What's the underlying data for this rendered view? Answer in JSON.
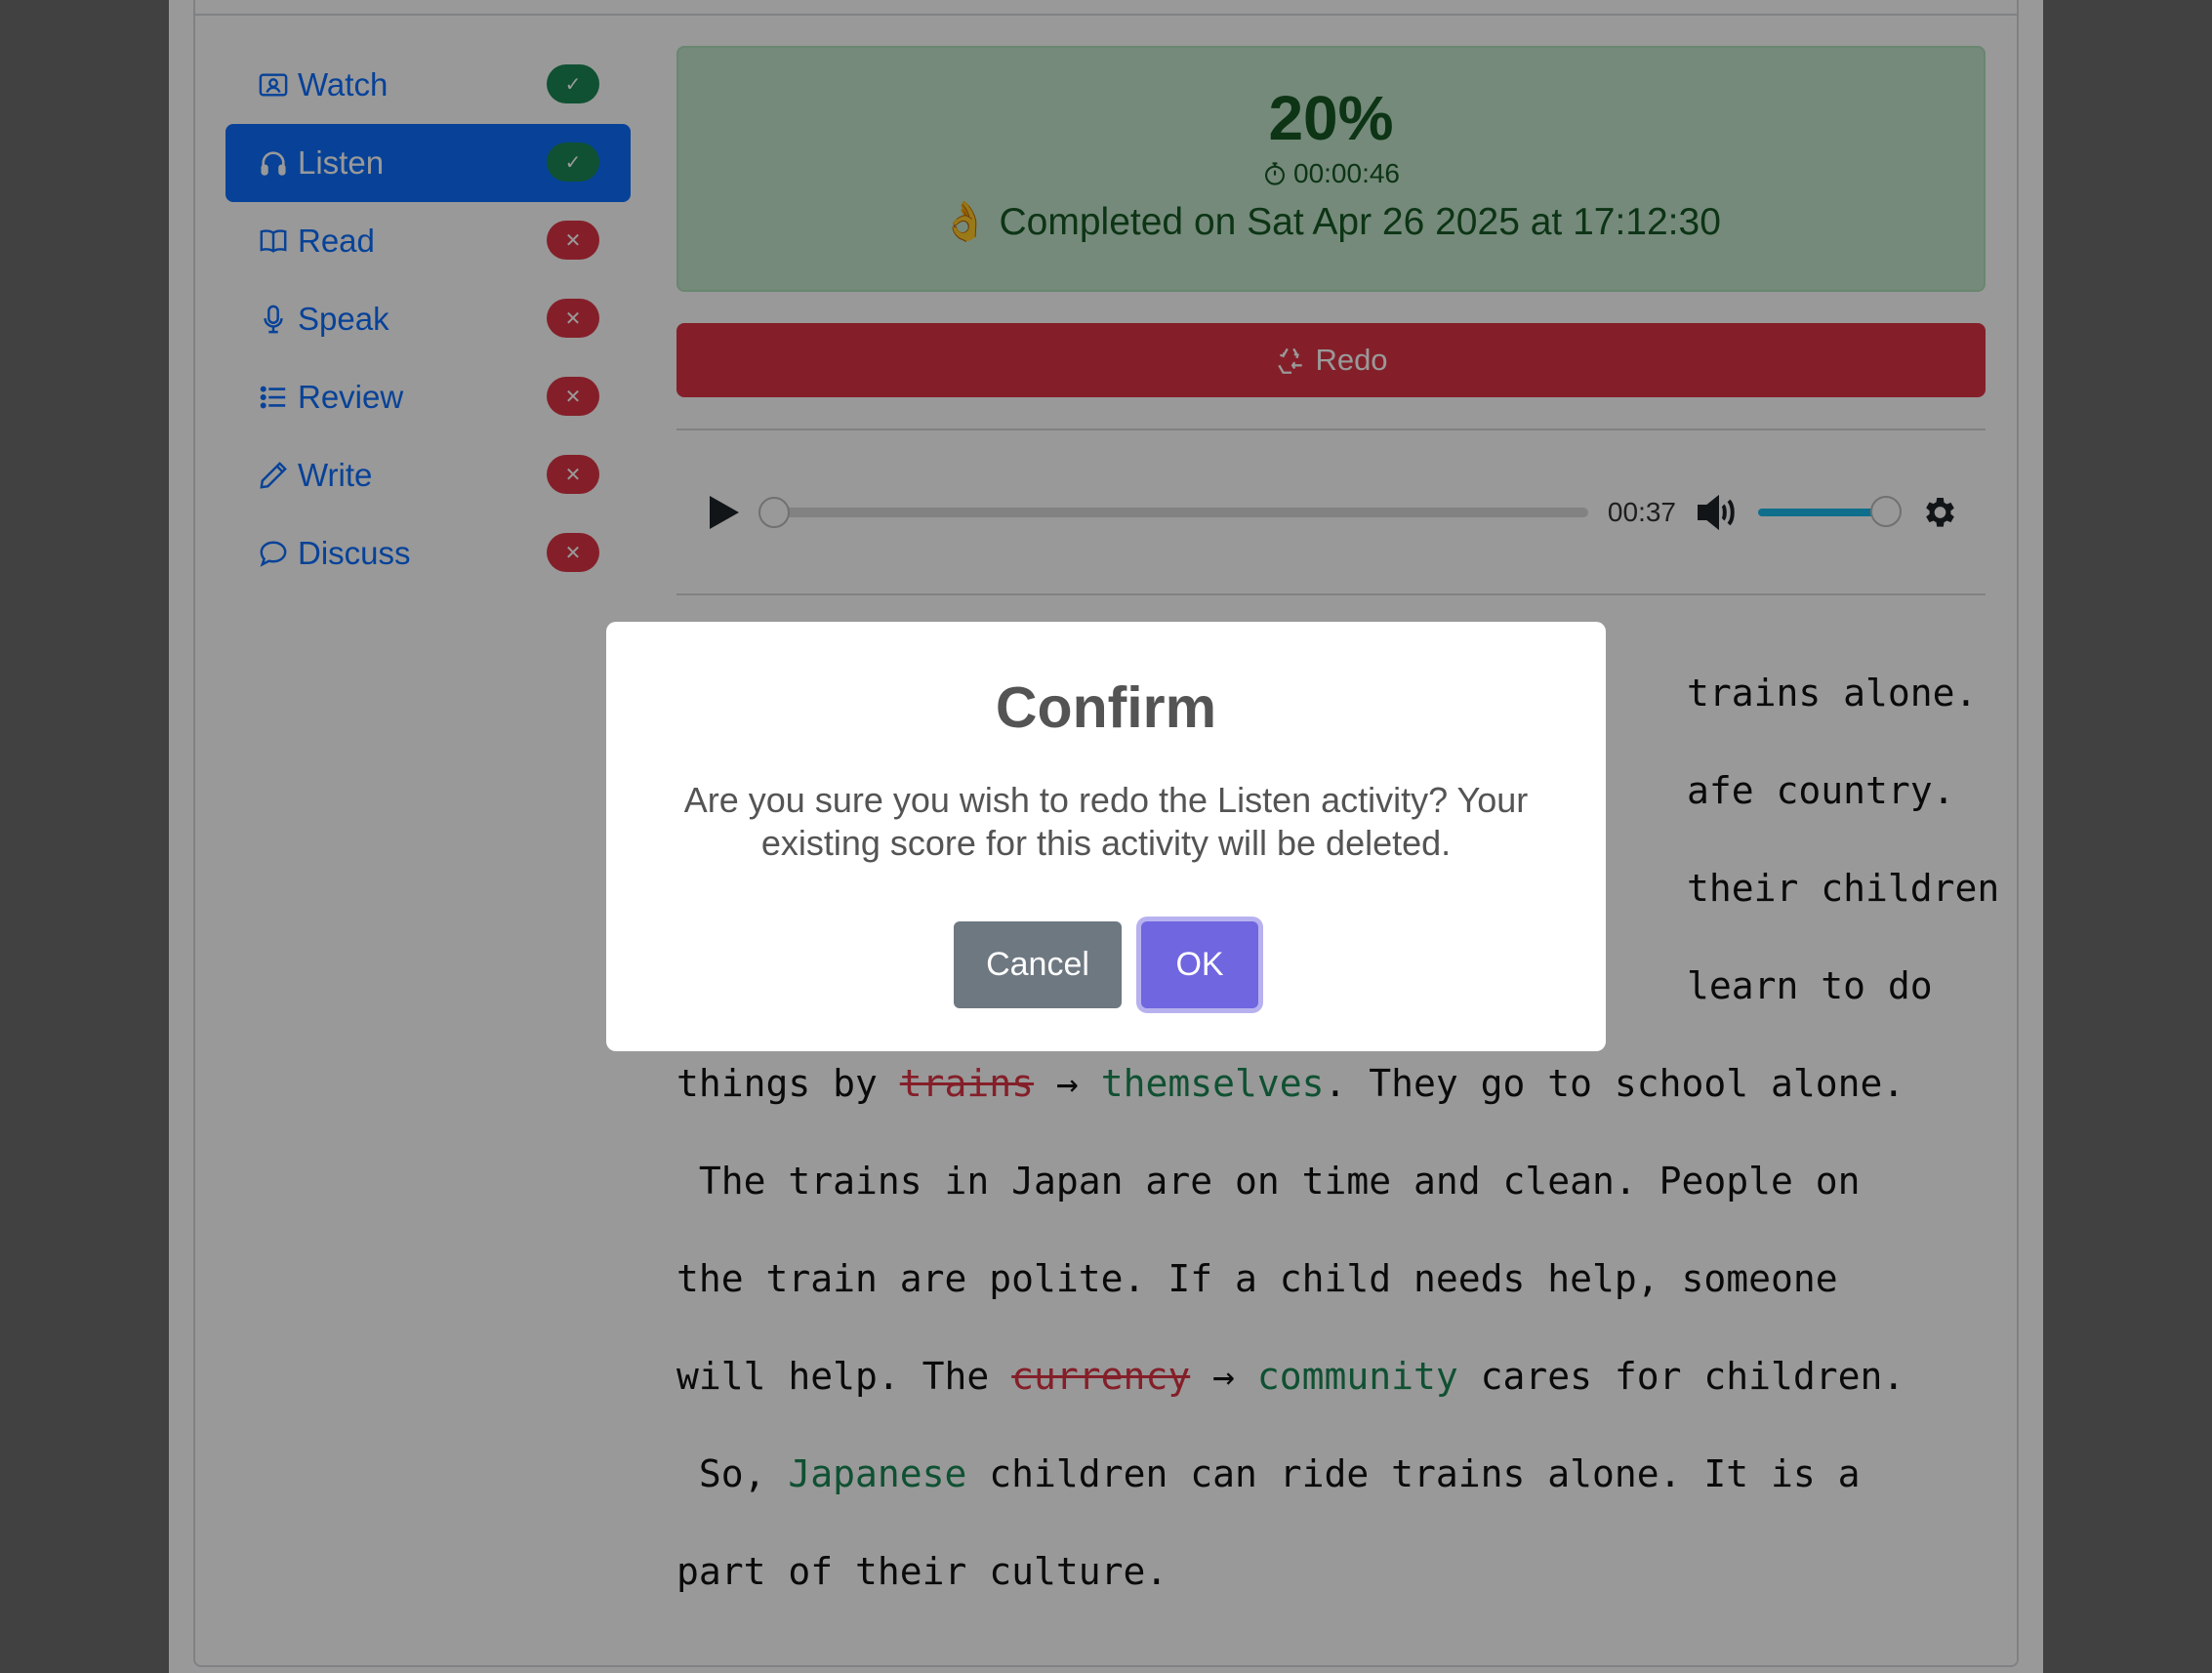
{
  "sidebar": {
    "items": [
      {
        "label": "Watch",
        "status": "✓"
      },
      {
        "label": "Listen",
        "status": "✓"
      },
      {
        "label": "Read",
        "status": "✕"
      },
      {
        "label": "Speak",
        "status": "✕"
      },
      {
        "label": "Review",
        "status": "✕"
      },
      {
        "label": "Write",
        "status": "✕"
      },
      {
        "label": "Discuss",
        "status": "✕"
      }
    ]
  },
  "result": {
    "score": "20%",
    "elapsed": "00:00:46",
    "completed": "👌 Completed on Sat Apr 26 2025 at 17:12:30"
  },
  "redo": {
    "label": "Redo"
  },
  "player": {
    "time": "00:37",
    "progress": 0.0,
    "volume": 1.0
  },
  "transcript": {
    "line1_tail": "trains alone.",
    "line2_tail": "afe country.",
    "line3_tail": "their children",
    "line4_tail": "learn to do",
    "line5": {
      "before": "things by ",
      "wrong": "trains",
      "arrow": " → ",
      "right": "themselves",
      "after": ". They go to school alone."
    },
    "line6": " The trains in Japan are on time and clean. People on",
    "line7": "the train are polite. If a child needs help, someone",
    "line8": {
      "before": "will help. The ",
      "wrong": "currency",
      "arrow": " → ",
      "right": "community",
      "after": " cares for children."
    },
    "line9": {
      "before": " So, ",
      "right": "Japanese",
      "after": " children can ride trains alone. It is a"
    },
    "line10": "part of their culture."
  },
  "modal": {
    "title": "Confirm",
    "message": "Are you sure you wish to redo the Listen activity? Your existing score for this activity will be deleted.",
    "cancel_label": "Cancel",
    "ok_label": "OK"
  },
  "colors": {
    "primary": "#0d6efd",
    "success": "#198754",
    "danger": "#dc3545",
    "confirm": "#7066e0"
  }
}
